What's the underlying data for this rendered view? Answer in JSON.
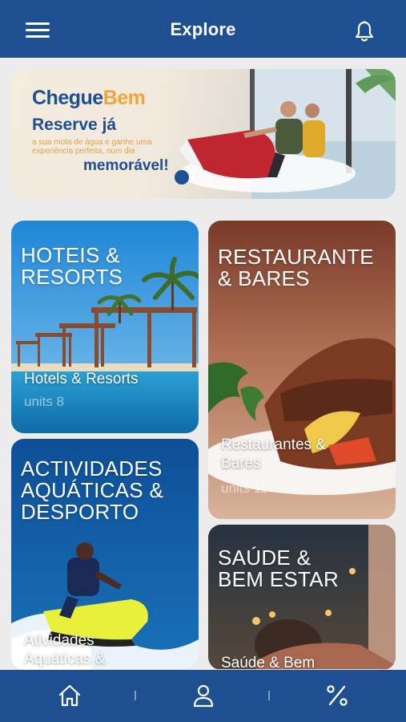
{
  "header": {
    "title": "Explore",
    "menu_icon": "menu-icon",
    "bell_icon": "bell-icon"
  },
  "banner": {
    "brand_part1": "Chegue",
    "brand_part2": "Bem",
    "headline": "Reserve já",
    "body": "a sua mota de água e ganhe uma experiência perfeita, num dia",
    "emphasis": "memorável!"
  },
  "cards": [
    {
      "heading_line1": "HOTEIS &",
      "heading_line2": "RESORTS",
      "label": "Hotels & Resorts",
      "units": "units 8"
    },
    {
      "heading_line1": "RESTAURANTE",
      "heading_line2": "& BARES",
      "label_line1": "Restaurantes &",
      "label_line2": "Bares",
      "units": "units 11"
    },
    {
      "heading_line1": "ACTIVIDADES",
      "heading_line2": "AQUÁTICAS &",
      "heading_line3": "DESPORTO",
      "label_line1": "Atividades",
      "label_line2": "Aquáticas &"
    },
    {
      "heading_line1": "SAÚDE &",
      "heading_line2": "BEM ESTAR",
      "label": "Saúde & Bem"
    }
  ],
  "bottom_nav": {
    "items": [
      "home-icon",
      "user-icon",
      "percent-icon"
    ]
  },
  "colors": {
    "primary": "#1d4f91",
    "accent": "#f0a53a",
    "background": "#ececec"
  }
}
